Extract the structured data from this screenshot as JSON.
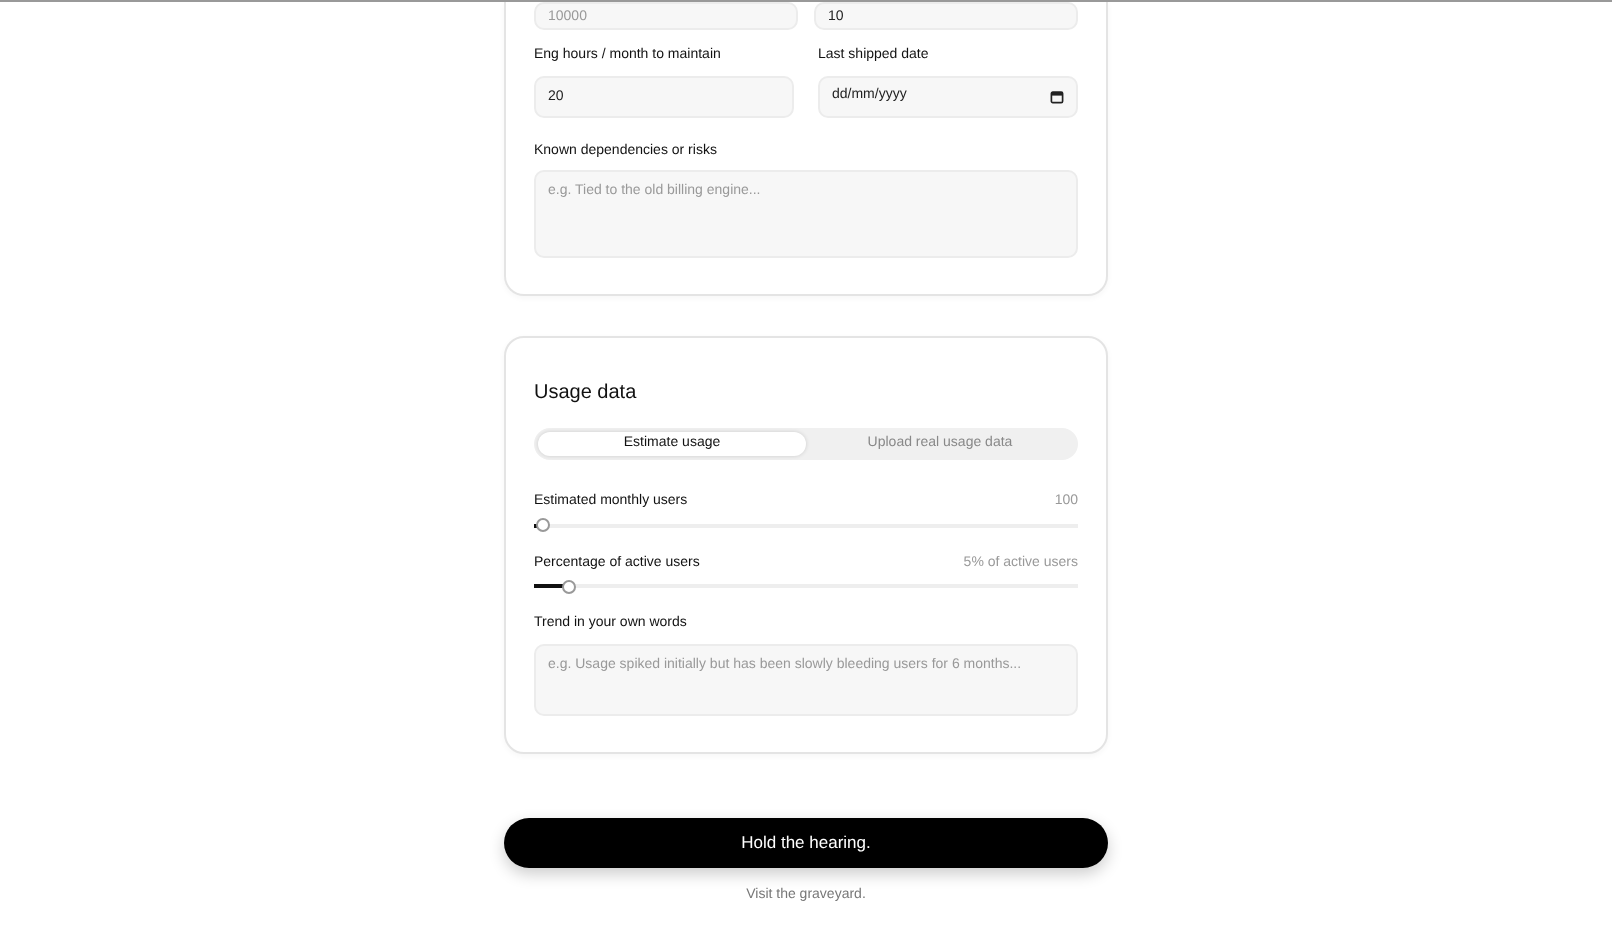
{
  "details_card": {
    "top_fields": [
      {
        "placeholder": "10000"
      },
      {
        "value": "10"
      }
    ],
    "fields": [
      {
        "label": "Eng hours / month to maintain",
        "kind": "text",
        "value": "20"
      },
      {
        "label": "Last shipped date",
        "kind": "date",
        "value": "dd/mm/yyyy"
      }
    ],
    "dependencies": {
      "label": "Known dependencies or risks",
      "placeholder": "e.g. Tied to the old billing engine..."
    }
  },
  "usage_card": {
    "title": "Usage data",
    "tabs": [
      {
        "label": "Estimate usage",
        "selected": true
      },
      {
        "label": "Upload real usage data",
        "selected": false
      }
    ],
    "sliders": [
      {
        "label": "Estimated monthly users",
        "reading": "100",
        "level": 0.01
      },
      {
        "label": "Percentage of active users",
        "reading": "5% of active users",
        "level": 0.06
      }
    ],
    "trend": {
      "label": "Trend in your own words",
      "placeholder": "e.g. Usage spiked initially but has been slowly bleeding users for 6 months..."
    }
  },
  "submit_button": "Hold the hearing.",
  "footer_link": "Visit the graveyard."
}
